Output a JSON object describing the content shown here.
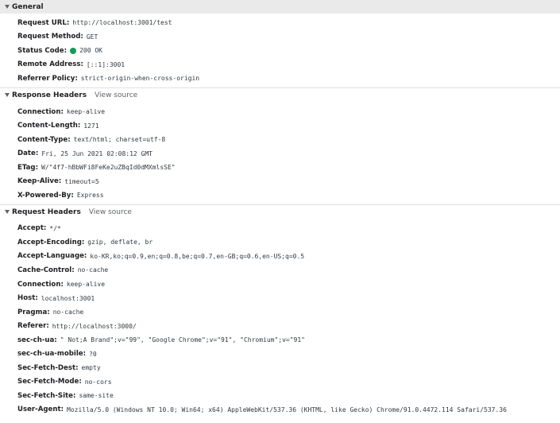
{
  "colors": {
    "status_ok": "#0f9d58",
    "section_bg": "#eaeaea"
  },
  "icons": {
    "collapse": "triangle-down-icon",
    "status": "status-dot-icon"
  },
  "general": {
    "title": "General",
    "rows": [
      {
        "key": "Request URL:",
        "value": "http://localhost:3001/test"
      },
      {
        "key": "Request Method:",
        "value": "GET"
      },
      {
        "key": "Status Code:",
        "value": "200 OK"
      },
      {
        "key": "Remote Address:",
        "value": "[::1]:3001"
      },
      {
        "key": "Referrer Policy:",
        "value": "strict-origin-when-cross-origin"
      }
    ]
  },
  "response_headers": {
    "title": "Response Headers",
    "view_source": "View source",
    "rows": [
      {
        "key": "Connection:",
        "value": "keep-alive"
      },
      {
        "key": "Content-Length:",
        "value": "1271"
      },
      {
        "key": "Content-Type:",
        "value": "text/html; charset=utf-8"
      },
      {
        "key": "Date:",
        "value": "Fri, 25 Jun 2021 02:08:12 GMT"
      },
      {
        "key": "ETag:",
        "value": "W/\"4f7-hBbWFi8FeKe2uZBqId0dMXmlsSE\""
      },
      {
        "key": "Keep-Alive:",
        "value": "timeout=5"
      },
      {
        "key": "X-Powered-By:",
        "value": "Express"
      }
    ]
  },
  "request_headers": {
    "title": "Request Headers",
    "view_source": "View source",
    "rows": [
      {
        "key": "Accept:",
        "value": "*/*"
      },
      {
        "key": "Accept-Encoding:",
        "value": "gzip, deflate, br"
      },
      {
        "key": "Accept-Language:",
        "value": "ko-KR,ko;q=0.9,en;q=0.8,be;q=0.7,en-GB;q=0.6,en-US;q=0.5"
      },
      {
        "key": "Cache-Control:",
        "value": "no-cache"
      },
      {
        "key": "Connection:",
        "value": "keep-alive"
      },
      {
        "key": "Host:",
        "value": "localhost:3001"
      },
      {
        "key": "Pragma:",
        "value": "no-cache"
      },
      {
        "key": "Referer:",
        "value": "http://localhost:3000/"
      },
      {
        "key": "sec-ch-ua:",
        "value": "\" Not;A Brand\";v=\"99\", \"Google Chrome\";v=\"91\", \"Chromium\";v=\"91\""
      },
      {
        "key": "sec-ch-ua-mobile:",
        "value": "?0"
      },
      {
        "key": "Sec-Fetch-Dest:",
        "value": "empty"
      },
      {
        "key": "Sec-Fetch-Mode:",
        "value": "no-cors"
      },
      {
        "key": "Sec-Fetch-Site:",
        "value": "same-site"
      },
      {
        "key": "User-Agent:",
        "value": "Mozilla/5.0 (Windows NT 10.0; Win64; x64) AppleWebKit/537.36 (KHTML, like Gecko) Chrome/91.0.4472.114 Safari/537.36"
      }
    ]
  }
}
